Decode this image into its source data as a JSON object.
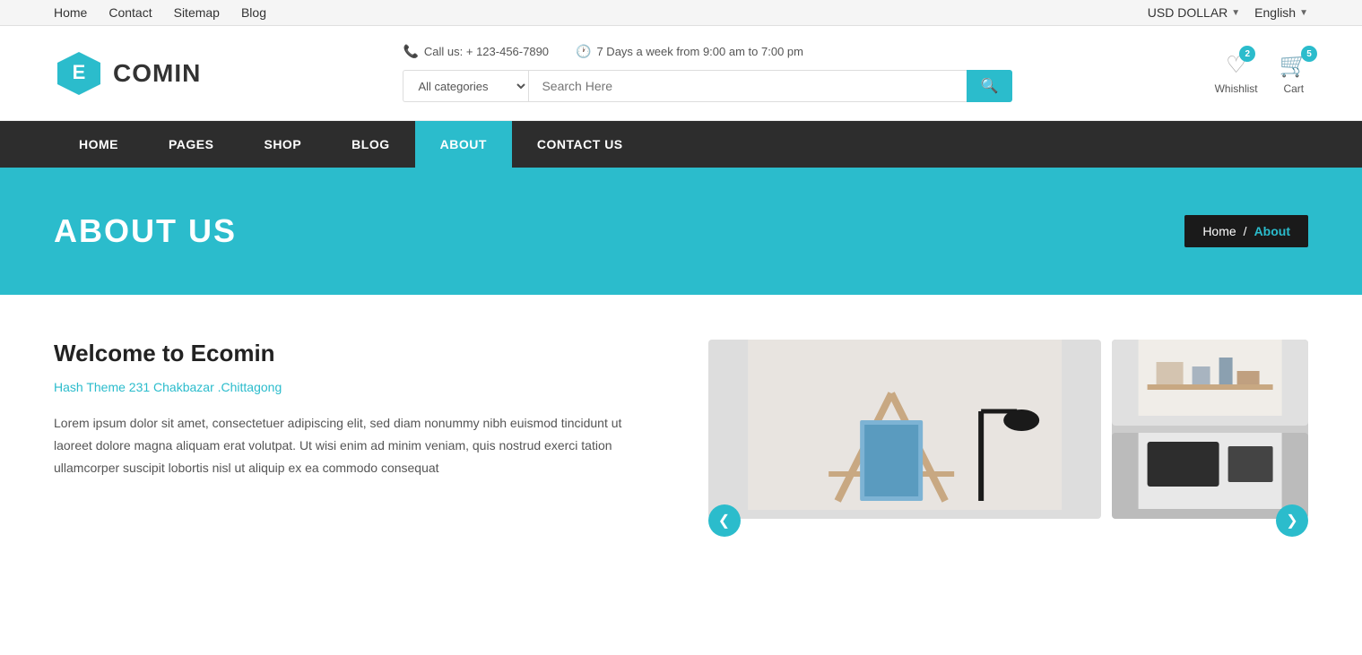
{
  "topbar": {
    "nav_links": [
      "Home",
      "Contact",
      "Sitemap",
      "Blog"
    ],
    "currency": "USD DOLLAR",
    "language": "English"
  },
  "header": {
    "logo_letter": "E",
    "logo_name": "COMIN",
    "phone_icon": "📞",
    "phone_label": "Call us: + 123-456-7890",
    "clock_icon": "🕐",
    "hours_label": "7 Days a week from 9:00 am to 7:00 pm",
    "search_placeholder": "Search Here",
    "search_select_default": "All categories",
    "wishlist_label": "Whishlist",
    "wishlist_count": "2",
    "cart_label": "Cart",
    "cart_count": "5"
  },
  "navbar": {
    "items": [
      {
        "label": "HOME",
        "active": false
      },
      {
        "label": "PAGES",
        "active": false
      },
      {
        "label": "SHOP",
        "active": false
      },
      {
        "label": "BLOG",
        "active": false
      },
      {
        "label": "ABOUT",
        "active": true
      },
      {
        "label": "CONTACT US",
        "active": false
      }
    ]
  },
  "hero": {
    "title": "ABOUT US",
    "breadcrumb_home": "Home",
    "breadcrumb_sep": "/",
    "breadcrumb_current": "About"
  },
  "content": {
    "welcome_title": "Welcome to Ecomin",
    "address": "Hash Theme 231 Chakbazar .Chittagong",
    "body_text": "Lorem ipsum dolor sit amet, consectetuer adipiscing elit, sed diam nonummy nibh euismod tincidunt ut laoreet dolore magna aliquam erat volutpat. Ut wisi enim ad minim veniam, quis nostrud exerci tation ullamcorper suscipit lobortis nisl ut aliquip ex ea commodo consequat"
  }
}
